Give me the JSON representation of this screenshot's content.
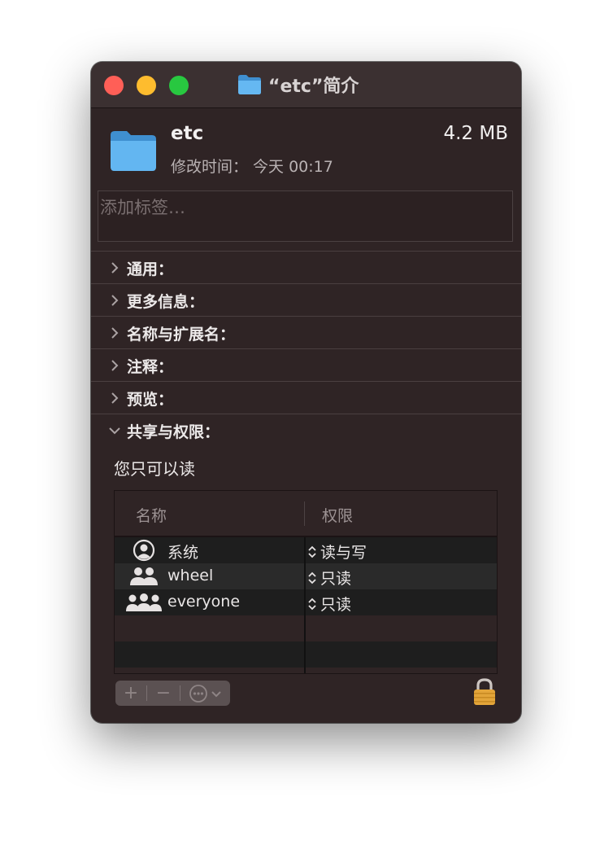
{
  "window": {
    "title": "“etc”简介"
  },
  "file": {
    "name": "etc",
    "size": "4.2 MB",
    "modified": "修改时间： 今天 00:17"
  },
  "tags": {
    "placeholder": "添加标签…"
  },
  "sections": [
    {
      "label": "通用：",
      "expanded": false
    },
    {
      "label": "更多信息：",
      "expanded": false
    },
    {
      "label": "名称与扩展名：",
      "expanded": false
    },
    {
      "label": "注释：",
      "expanded": false
    },
    {
      "label": "预览：",
      "expanded": false
    },
    {
      "label": "共享与权限：",
      "expanded": true
    }
  ],
  "permissions": {
    "note": "您只可以读",
    "columns": [
      "名称",
      "权限"
    ],
    "rows": [
      {
        "name": "系统",
        "privilege": "读与写",
        "icon": "user-circle-icon"
      },
      {
        "name": "wheel",
        "privilege": "只读",
        "icon": "group-icon"
      },
      {
        "name": "everyone",
        "privilege": "只读",
        "icon": "everyone-icon"
      }
    ]
  },
  "toolbar": {
    "add": "+",
    "remove": "−"
  },
  "colors": {
    "window_bg": "#2f2425",
    "titlebar_bg": "#3b3031",
    "close": "#ff5f57",
    "minimize": "#febc2e",
    "zoom": "#28c840",
    "folder_blue": "#5fb4f0"
  }
}
